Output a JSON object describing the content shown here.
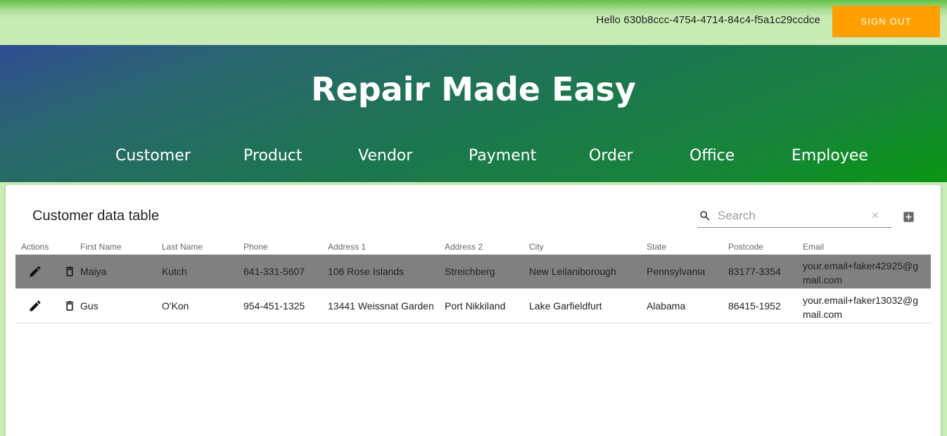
{
  "topbar": {
    "greeting": "Hello 630b8ccc-4754-4714-84c4-f5a1c29ccdce",
    "signout_label": "SIGN OUT"
  },
  "hero": {
    "title": "Repair Made Easy",
    "nav": [
      "Customer",
      "Product",
      "Vendor",
      "Payment",
      "Order",
      "Office",
      "Employee"
    ]
  },
  "table": {
    "title": "Customer data table",
    "search_placeholder": "Search",
    "columns": [
      "Actions",
      "First Name",
      "Last Name",
      "Phone",
      "Address 1",
      "Address 2",
      "City",
      "State",
      "Postcode",
      "Email"
    ],
    "rows": [
      {
        "first_name": "Maiya",
        "last_name": "Kutch",
        "phone": "641-331-5607",
        "address1": "106 Rose Islands",
        "address2": "Streichberg",
        "city": "New Leilaniborough",
        "state": "Pennsylvania",
        "postcode": "83177-3354",
        "email": "your.email+faker42925@gmail.com",
        "selected": true
      },
      {
        "first_name": "Gus",
        "last_name": "O'Kon",
        "phone": "954-451-1325",
        "address1": "13441 Weissnat Garden",
        "address2": "Port Nikkiland",
        "city": "Lake Garfieldfurt",
        "state": "Alabama",
        "postcode": "86415-1952",
        "email": "your.email+faker13032@gmail.com",
        "selected": false
      }
    ]
  },
  "colors": {
    "signout_bg": "#ffa000",
    "selected_row": "#808080",
    "page_bg": "#c9ebb5"
  },
  "icons": [
    "search-icon",
    "clear-icon",
    "add-box-icon",
    "edit-icon",
    "delete-icon"
  ]
}
